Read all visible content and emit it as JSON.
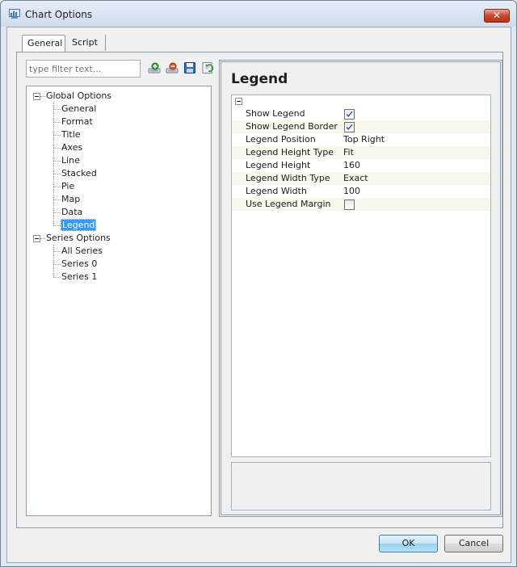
{
  "window": {
    "title": "Chart Options",
    "close_symbol": "✕"
  },
  "tabs": [
    {
      "label": "General",
      "active": true
    },
    {
      "label": "Script",
      "active": false
    }
  ],
  "filter": {
    "placeholder": "type filter text..."
  },
  "toolbar_icons": [
    "add-icon",
    "remove-icon",
    "save-icon",
    "refresh-icon"
  ],
  "tree": {
    "global": {
      "label": "Global Options",
      "children": [
        "General",
        "Format",
        "Title",
        "Axes",
        "Line",
        "Stacked",
        "Pie",
        "Map",
        "Data",
        "Legend"
      ]
    },
    "series": {
      "label": "Series Options",
      "children": [
        "All Series",
        "Series 0",
        "Series 1"
      ]
    },
    "selected": "Legend"
  },
  "panel": {
    "heading": "Legend",
    "properties": [
      {
        "name": "Show Legend",
        "type": "checkbox",
        "value": true
      },
      {
        "name": "Show Legend Border",
        "type": "checkbox",
        "value": true
      },
      {
        "name": "Legend Position",
        "type": "text",
        "value": "Top Right"
      },
      {
        "name": "Legend Height Type",
        "type": "text",
        "value": "Fit"
      },
      {
        "name": "Legend Height",
        "type": "text",
        "value": "160"
      },
      {
        "name": "Legend Width Type",
        "type": "text",
        "value": "Exact"
      },
      {
        "name": "Legend Width",
        "type": "text",
        "value": "100"
      },
      {
        "name": "Use Legend Margin",
        "type": "checkbox",
        "value": false
      }
    ]
  },
  "buttons": {
    "ok": "OK",
    "cancel": "Cancel"
  },
  "colors": {
    "selection": "#3399ff",
    "title_bar": "#cfdcec",
    "close_button": "#c9462c",
    "check": "#2a4d9c"
  }
}
